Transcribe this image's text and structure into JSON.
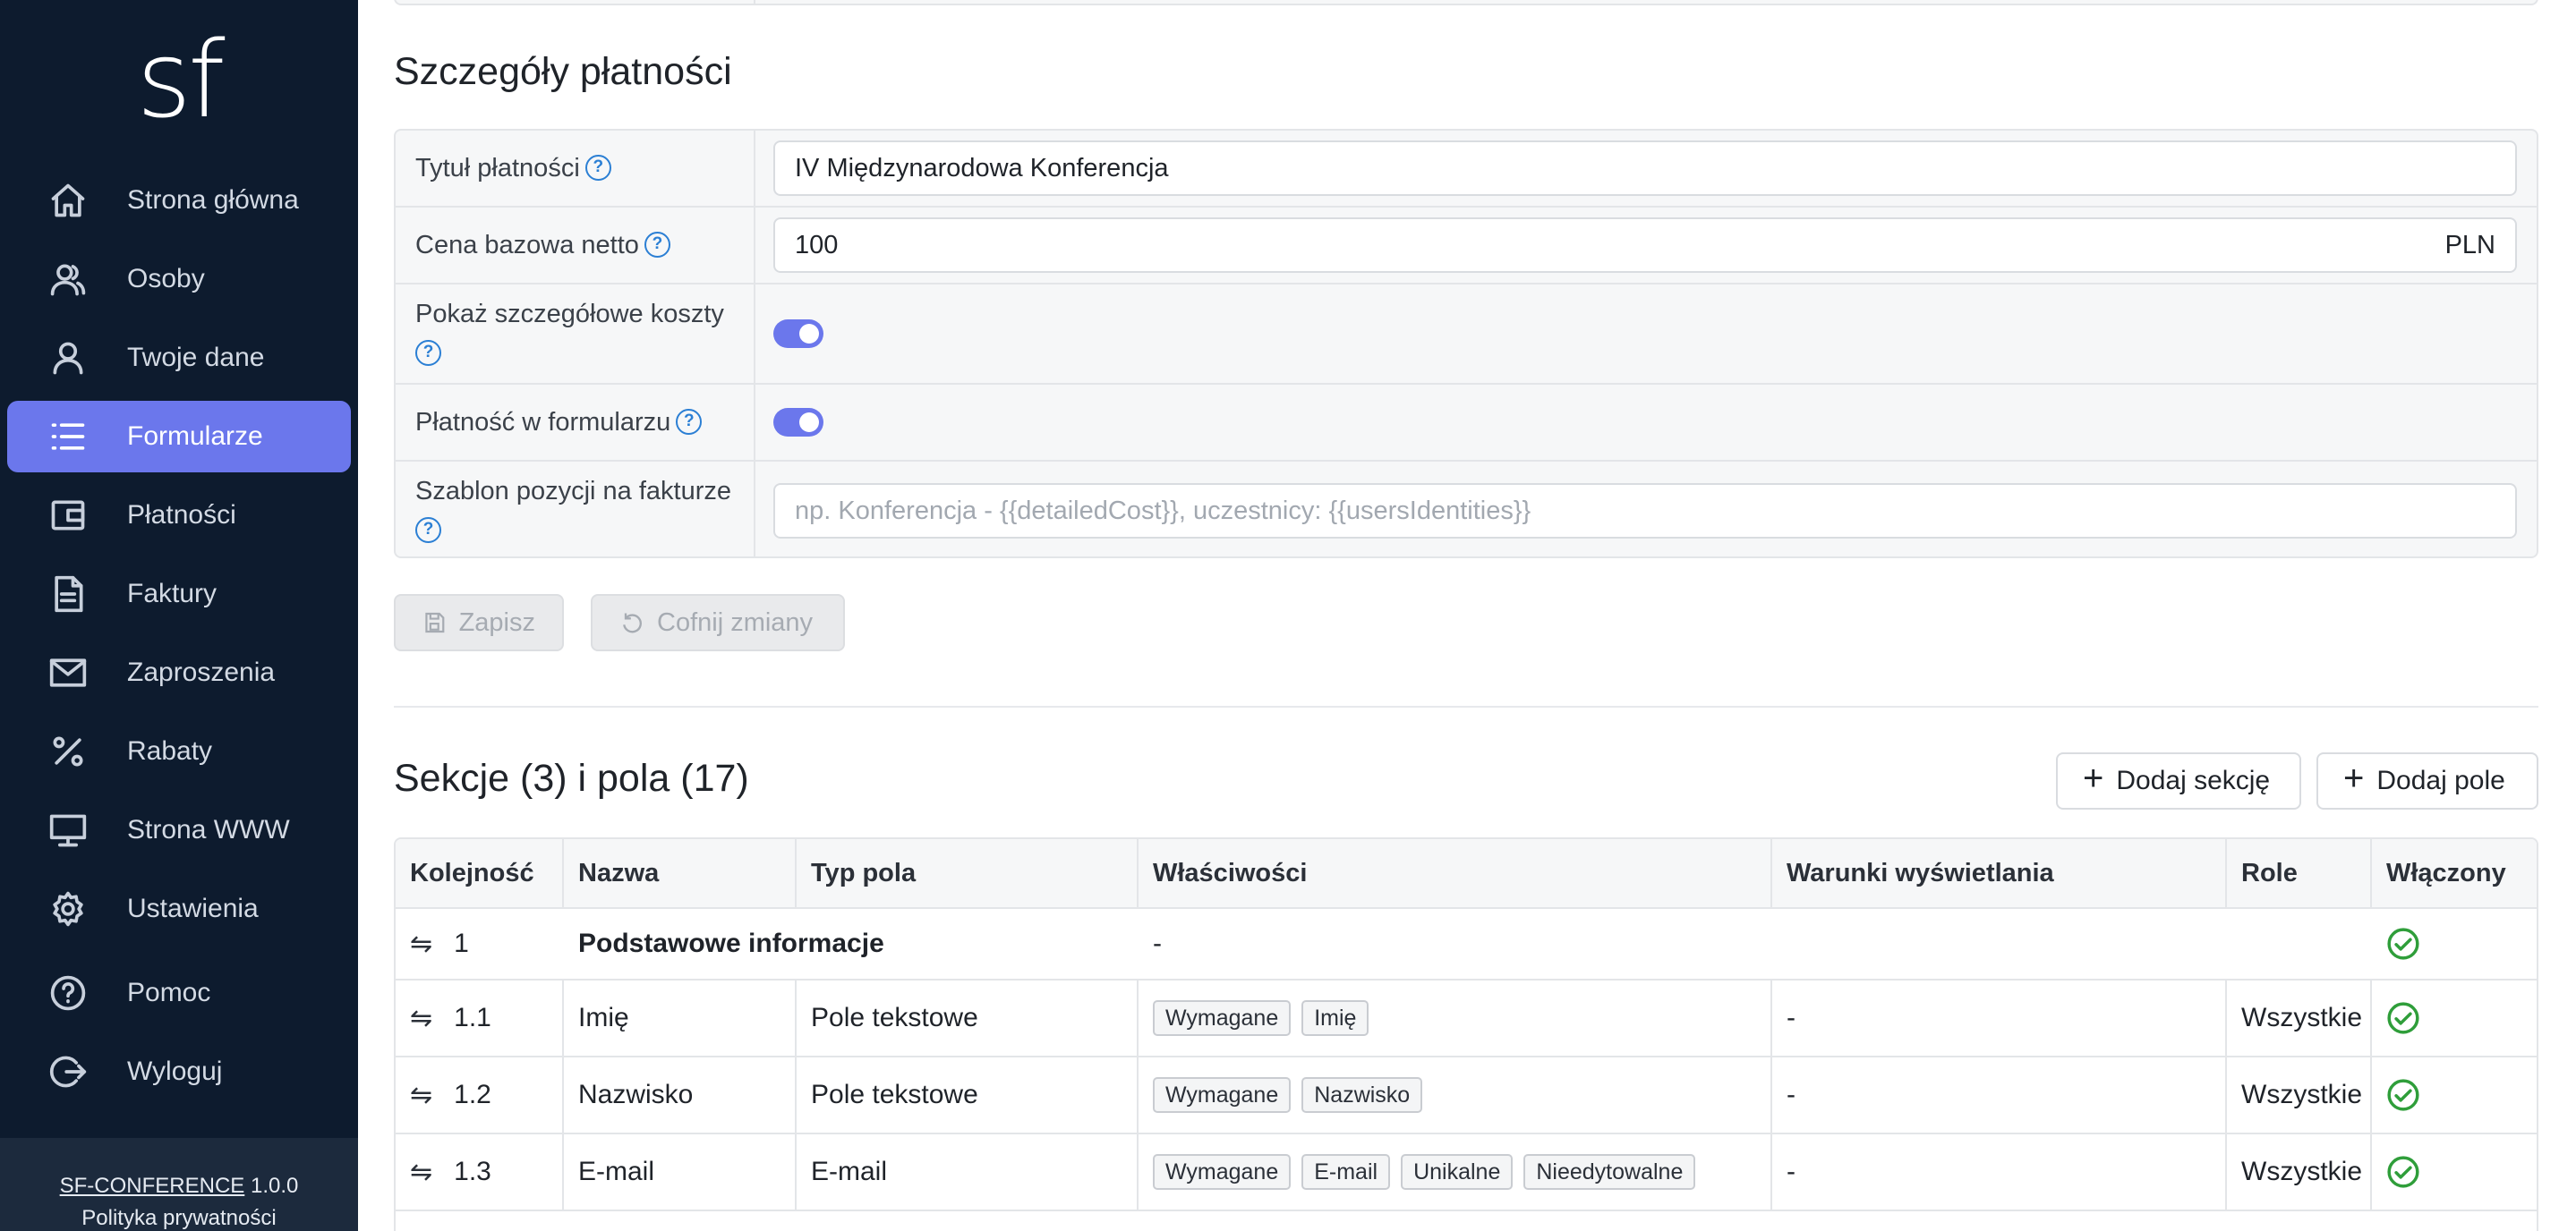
{
  "sidebar": {
    "logo": "sf",
    "items": [
      {
        "label": "Strona główna",
        "icon": "home-icon"
      },
      {
        "label": "Osoby",
        "icon": "users-icon"
      },
      {
        "label": "Twoje dane",
        "icon": "user-icon"
      },
      {
        "label": "Formularze",
        "icon": "list-icon",
        "active": true
      },
      {
        "label": "Płatności",
        "icon": "wallet-icon"
      },
      {
        "label": "Faktury",
        "icon": "document-icon"
      },
      {
        "label": "Zaproszenia",
        "icon": "mail-icon"
      },
      {
        "label": "Rabaty",
        "icon": "percent-icon"
      },
      {
        "label": "Strona WWW",
        "icon": "monitor-icon"
      },
      {
        "label": "Ustawienia",
        "icon": "gear-icon"
      },
      {
        "label": "Pomoc",
        "icon": "help-icon"
      },
      {
        "label": "Wyloguj",
        "icon": "logout-icon"
      }
    ],
    "footer": {
      "app_name": "SF-CONFERENCE",
      "version": "1.0.0",
      "privacy": "Polityka prywatności"
    }
  },
  "payment": {
    "title": "Szczegóły płatności",
    "fields": {
      "title_label": "Tytuł płatności",
      "title_value": "IV Międzynarodowa Konferencja",
      "price_label": "Cena bazowa netto",
      "price_value": "100",
      "price_currency": "PLN",
      "detailed_costs_label": "Pokaż szczegółowe koszty",
      "detailed_costs_on": true,
      "in_form_label": "Płatność w formularzu",
      "in_form_on": true,
      "invoice_template_label": "Szablon pozycji na fakturze",
      "invoice_template_placeholder": "np. Konferencja - {{detailedCost}}, uczestnicy: {{usersIdentities}}"
    },
    "save_label": "Zapisz",
    "revert_label": "Cofnij zmiany"
  },
  "sections": {
    "title": "Sekcje (3) i pola (17)",
    "add_section_label": "Dodaj sekcję",
    "add_field_label": "Dodaj pole",
    "columns": [
      "Kolejność",
      "Nazwa",
      "Typ pola",
      "Właściwości",
      "Warunki wyświetlania",
      "Role",
      "Włączony"
    ],
    "section_row": {
      "order": "1",
      "name": "Podstawowe informacje",
      "properties": "-",
      "enabled": true
    },
    "rows": [
      {
        "order": "1.1",
        "name": "Imię",
        "type": "Pole tekstowe",
        "tags": [
          "Wymagane",
          "Imię"
        ],
        "conditions": "-",
        "roles": "Wszystkie",
        "enabled": true
      },
      {
        "order": "1.2",
        "name": "Nazwisko",
        "type": "Pole tekstowe",
        "tags": [
          "Wymagane",
          "Nazwisko"
        ],
        "conditions": "-",
        "roles": "Wszystkie",
        "enabled": true
      },
      {
        "order": "1.3",
        "name": "E-mail",
        "type": "E-mail",
        "tags": [
          "Wymagane",
          "E-mail",
          "Unikalne",
          "Nieedytowalne"
        ],
        "conditions": "-",
        "roles": "Wszystkie",
        "enabled": true
      }
    ]
  }
}
